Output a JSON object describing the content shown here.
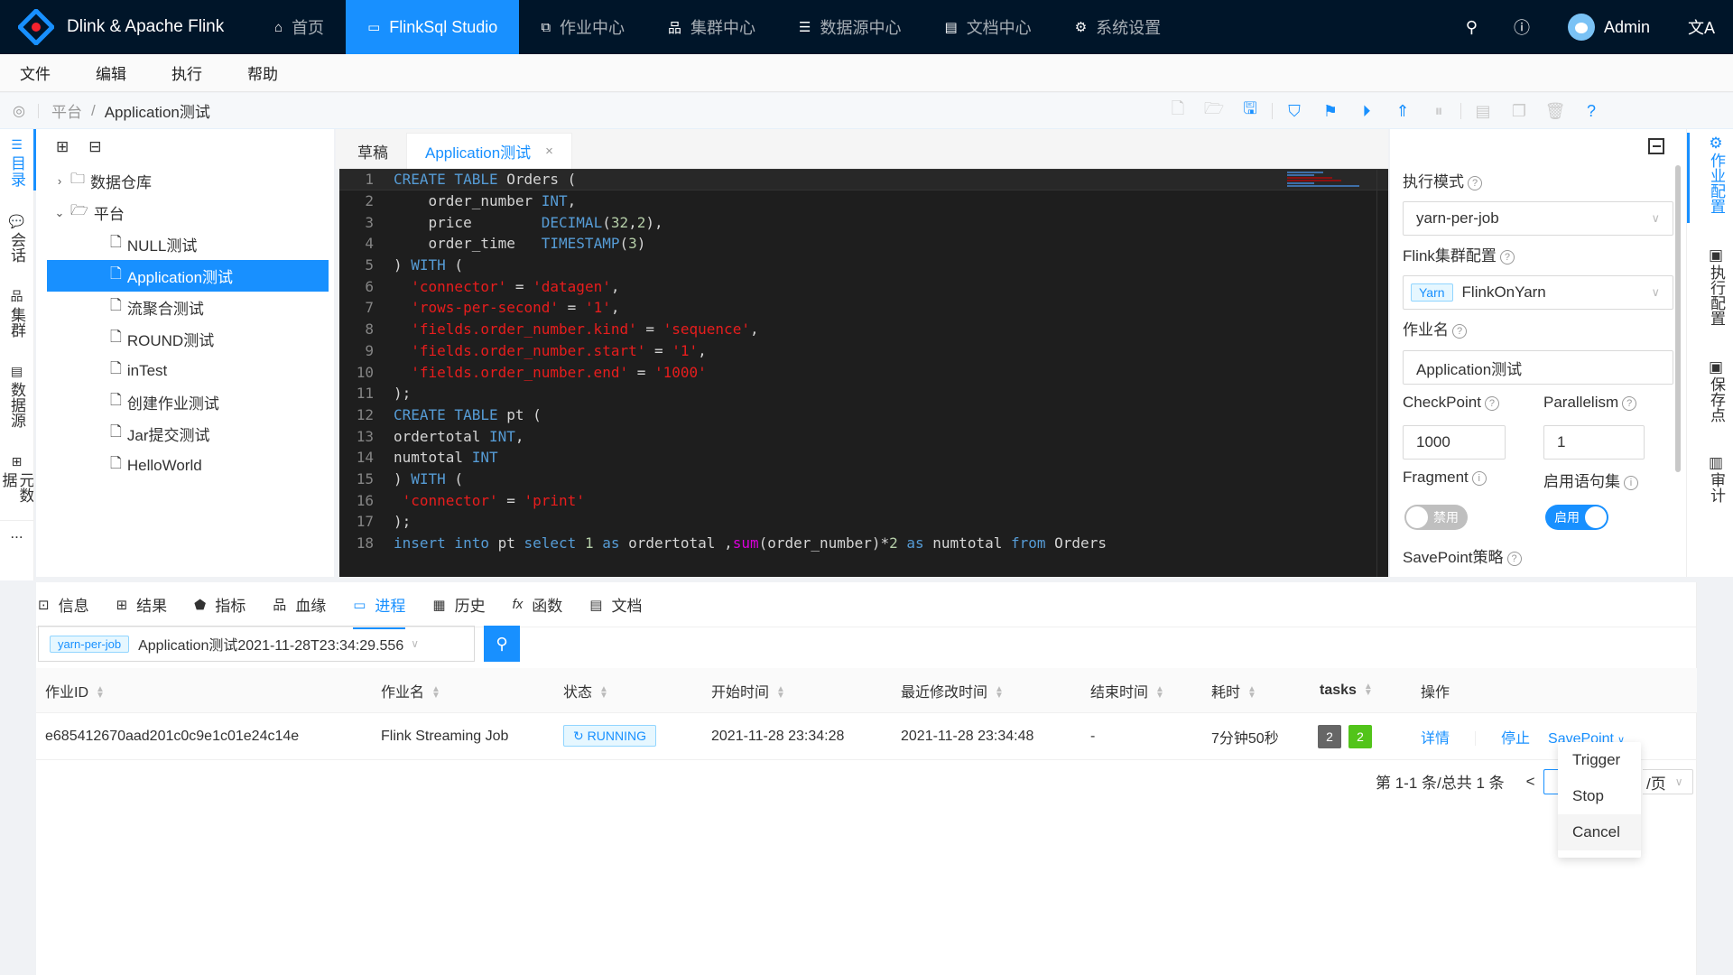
{
  "header": {
    "app_title": "Dlink & Apache Flink",
    "nav": [
      {
        "label": "首页",
        "icon": "home-icon",
        "active": false
      },
      {
        "label": "FlinkSql Studio",
        "icon": "sql-monitor-icon",
        "active": true
      },
      {
        "label": "作业中心",
        "icon": "cluster-nodes-icon",
        "active": false
      },
      {
        "label": "集群中心",
        "icon": "cluster-icon",
        "active": false
      },
      {
        "label": "数据源中心",
        "icon": "database-icon",
        "active": false
      },
      {
        "label": "文档中心",
        "icon": "document-icon",
        "active": false
      },
      {
        "label": "系统设置",
        "icon": "gear-icon",
        "active": false
      }
    ],
    "user": "Admin"
  },
  "menubar": [
    "文件",
    "编辑",
    "执行",
    "帮助"
  ],
  "breadcrumb": {
    "root": "平台",
    "current": "Application测试"
  },
  "left_rail": [
    {
      "label": "目录",
      "icon": "list-icon",
      "active": true
    },
    {
      "label": "会话",
      "icon": "chat-icon",
      "active": false
    },
    {
      "label": "集群",
      "icon": "cluster-icon",
      "active": false
    },
    {
      "label": "数据源",
      "icon": "database-icon",
      "active": false
    },
    {
      "label": "元数据",
      "icon": "grid-icon",
      "active": false
    }
  ],
  "left_rail_more": "...",
  "tree": {
    "folders": [
      {
        "label": "数据仓库",
        "expanded": false
      },
      {
        "label": "平台",
        "expanded": true
      }
    ],
    "files": [
      "NULL测试",
      "Application测试",
      "流聚合测试",
      "ROUND测试",
      "inTest",
      "创建作业测试",
      "Jar提交测试",
      "HelloWorld"
    ],
    "selected": "Application测试"
  },
  "editor": {
    "tabs": [
      {
        "label": "草稿",
        "active": false
      },
      {
        "label": "Application测试",
        "active": true,
        "closable": true
      }
    ],
    "close_glyph": "×"
  },
  "config": {
    "exec_mode_label": "执行模式",
    "exec_mode_value": "yarn-per-job",
    "cluster_label": "Flink集群配置",
    "cluster_tag": "Yarn",
    "cluster_value": "FlinkOnYarn",
    "job_name_label": "作业名",
    "job_name_value": "Application测试",
    "checkpoint_label": "CheckPoint",
    "checkpoint_value": "1000",
    "parallelism_label": "Parallelism",
    "parallelism_value": "1",
    "fragment_label": "Fragment",
    "fragment_switch": "禁用",
    "fragment_on": false,
    "statement_set_label": "启用语句集",
    "statement_set_switch": "启用",
    "statement_set_on": true,
    "savepoint_label": "SavePoint策略"
  },
  "right_rail": [
    {
      "label": "作业配置",
      "active": true
    },
    {
      "label": "执行配置",
      "active": false
    },
    {
      "label": "保存点",
      "active": false
    },
    {
      "label": "审计",
      "active": false
    }
  ],
  "bottom": {
    "tabs": [
      {
        "label": "信息",
        "icon": "terminal-icon"
      },
      {
        "label": "结果",
        "icon": "table-icon"
      },
      {
        "label": "指标",
        "icon": "radar-icon"
      },
      {
        "label": "血缘",
        "icon": "lineage-icon"
      },
      {
        "label": "进程",
        "icon": "desktop-icon",
        "active": true
      },
      {
        "label": "历史",
        "icon": "calendar-icon"
      },
      {
        "label": "函数",
        "icon": "function-icon"
      },
      {
        "label": "文档",
        "icon": "doc-search-icon"
      }
    ],
    "job_select": {
      "tag": "yarn-per-job",
      "value": "Application测试2021-11-28T23:34:29.556"
    },
    "columns": [
      "作业ID",
      "作业名",
      "状态",
      "开始时间",
      "最近修改时间",
      "结束时间",
      "耗时",
      "tasks",
      "操作"
    ],
    "rows": [
      {
        "job_id": "e685412670aad201c0c9e1c01e24c14e",
        "job_name": "Flink Streaming Job",
        "status": "RUNNING",
        "start_time": "2021-11-28 23:34:28",
        "modify_time": "2021-11-28 23:34:48",
        "end_time": "-",
        "duration": "7分钟50秒",
        "tasks_total": "2",
        "tasks_running": "2",
        "actions": {
          "detail": "详情",
          "stop": "停止",
          "savepoint": "SavePoint"
        }
      }
    ],
    "pagination": {
      "summary": "第 1-1 条/总共 1 条",
      "prev": "<",
      "page_size_suffix": "/页"
    },
    "savepoint_menu": [
      "Trigger",
      "Stop",
      "Cancel"
    ],
    "colors": {
      "tasks_total": "#666666",
      "tasks_running": "#52c41a",
      "accent": "#1890ff"
    }
  },
  "code_lines": [
    [
      [
        "kw",
        "CREATE TABLE "
      ],
      [
        "t",
        "Orders ("
      ]
    ],
    [
      [
        "t",
        "    order_number "
      ],
      [
        "kw",
        "INT"
      ],
      [
        "t",
        ","
      ]
    ],
    [
      [
        "t",
        "    price        "
      ],
      [
        "kw",
        "DECIMAL"
      ],
      [
        "t",
        "("
      ],
      [
        "num",
        "32"
      ],
      [
        "t",
        ","
      ],
      [
        "num",
        "2"
      ],
      [
        "t",
        "),"
      ]
    ],
    [
      [
        "t",
        "    order_time   "
      ],
      [
        "kw",
        "TIMESTAMP"
      ],
      [
        "t",
        "("
      ],
      [
        "num",
        "3"
      ],
      [
        "t",
        ")"
      ]
    ],
    [
      [
        "t",
        ") "
      ],
      [
        "kw",
        "WITH"
      ],
      [
        "t",
        " ("
      ]
    ],
    [
      [
        "t",
        "  "
      ],
      [
        "str",
        "'connector'"
      ],
      [
        "t",
        " = "
      ],
      [
        "str",
        "'datagen'"
      ],
      [
        "t",
        ","
      ]
    ],
    [
      [
        "t",
        "  "
      ],
      [
        "str",
        "'rows-per-second'"
      ],
      [
        "t",
        " = "
      ],
      [
        "str",
        "'1'"
      ],
      [
        "t",
        ","
      ]
    ],
    [
      [
        "t",
        "  "
      ],
      [
        "str",
        "'fields.order_number.kind'"
      ],
      [
        "t",
        " = "
      ],
      [
        "str",
        "'sequence'"
      ],
      [
        "t",
        ","
      ]
    ],
    [
      [
        "t",
        "  "
      ],
      [
        "str",
        "'fields.order_number.start'"
      ],
      [
        "t",
        " = "
      ],
      [
        "str",
        "'1'"
      ],
      [
        "t",
        ","
      ]
    ],
    [
      [
        "t",
        "  "
      ],
      [
        "str",
        "'fields.order_number.end'"
      ],
      [
        "t",
        " = "
      ],
      [
        "str",
        "'1000'"
      ]
    ],
    [
      [
        "t",
        ");"
      ]
    ],
    [
      [
        "kw",
        "CREATE TABLE "
      ],
      [
        "t",
        "pt ("
      ]
    ],
    [
      [
        "t",
        "ordertotal "
      ],
      [
        "kw",
        "INT"
      ],
      [
        "t",
        ","
      ]
    ],
    [
      [
        "t",
        "numtotal "
      ],
      [
        "kw",
        "INT"
      ]
    ],
    [
      [
        "t",
        ") "
      ],
      [
        "kw",
        "WITH"
      ],
      [
        "t",
        " ("
      ]
    ],
    [
      [
        "t",
        " "
      ],
      [
        "str",
        "'connector'"
      ],
      [
        "t",
        " = "
      ],
      [
        "str",
        "'print'"
      ]
    ],
    [
      [
        "t",
        ");"
      ]
    ],
    [
      [
        "kw",
        "insert into "
      ],
      [
        "t",
        "pt "
      ],
      [
        "kw",
        "select "
      ],
      [
        "num",
        "1"
      ],
      [
        "kw",
        " as "
      ],
      [
        "t",
        "ordertotal ,"
      ],
      [
        "fn",
        "sum"
      ],
      [
        "t",
        "(order_number)*"
      ],
      [
        "num",
        "2"
      ],
      [
        "kw",
        " as "
      ],
      [
        "t",
        "numtotal "
      ],
      [
        "kw",
        "from "
      ],
      [
        "t",
        "Orders"
      ]
    ]
  ]
}
